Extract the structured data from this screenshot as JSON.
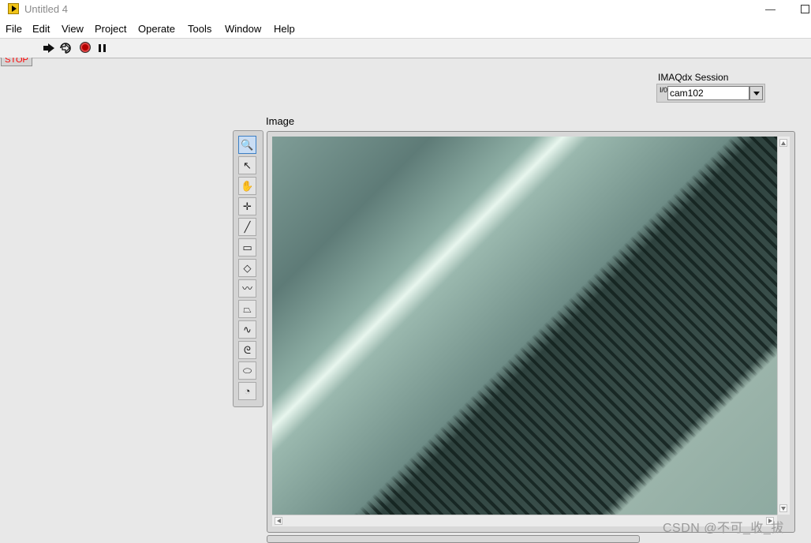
{
  "window": {
    "title": "Untitled 4",
    "minimize": "—"
  },
  "menu": [
    "File",
    "Edit",
    "View",
    "Project",
    "Operate",
    "Tools",
    "Window",
    "Help"
  ],
  "toolbar": {
    "icons": [
      "run-arrow-icon",
      "run-continuously-icon",
      "abort-execution-icon",
      "pause-icon"
    ]
  },
  "front_panel": {
    "stop_label": "STOP",
    "session": {
      "label": "IMAQdx Session",
      "io_glyph": "I/0",
      "value": "cam102"
    },
    "image": {
      "label": "Image"
    }
  },
  "tools_palette": [
    {
      "icon": "zoom-icon",
      "glyph": "🔍",
      "active": true
    },
    {
      "icon": "pointer-icon",
      "glyph": "↖"
    },
    {
      "icon": "pan-hand-icon",
      "glyph": "✋"
    },
    {
      "icon": "crosshair-point-icon",
      "glyph": "✛"
    },
    {
      "icon": "line-icon",
      "glyph": "╱"
    },
    {
      "icon": "rectangle-icon",
      "glyph": "▭"
    },
    {
      "icon": "rotated-rectangle-icon",
      "glyph": "◇"
    },
    {
      "icon": "polyline-icon",
      "glyph": "〰"
    },
    {
      "icon": "polygon-icon",
      "glyph": "⏢"
    },
    {
      "icon": "freehand-line-icon",
      "glyph": "∿"
    },
    {
      "icon": "freehand-region-icon",
      "glyph": "ᘓ"
    },
    {
      "icon": "oval-icon",
      "glyph": "⬭"
    },
    {
      "icon": "annulus-icon",
      "glyph": "◔"
    }
  ],
  "watermark": "CSDN @不可_收_拔"
}
